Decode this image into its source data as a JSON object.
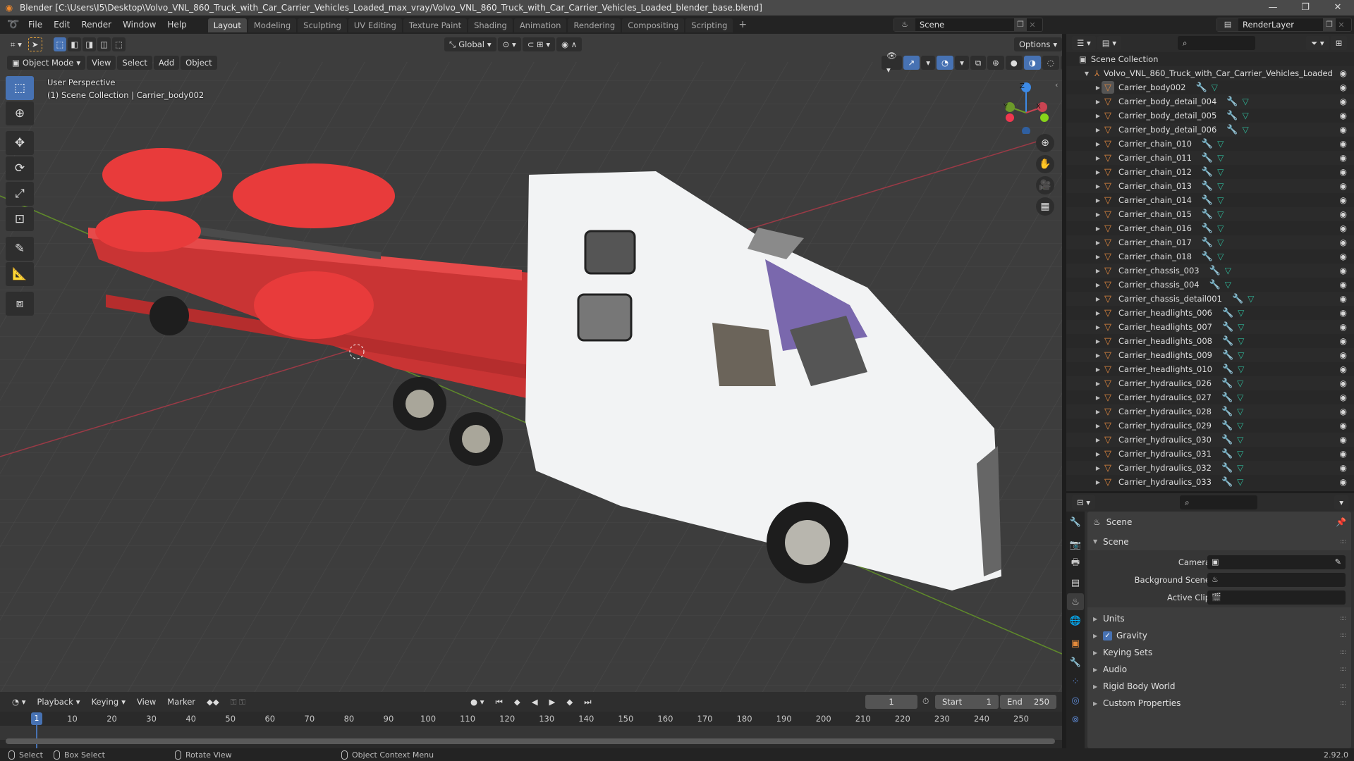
{
  "window": {
    "title": "Blender [C:\\Users\\I5\\Desktop\\Volvo_VNL_860_Truck_with_Car_Carrier_Vehicles_Loaded_max_vray/Volvo_VNL_860_Truck_with_Car_Carrier_Vehicles_Loaded_blender_base.blend]",
    "minimize": "—",
    "maximize": "❐",
    "close": "✕"
  },
  "menu": [
    "File",
    "Edit",
    "Render",
    "Window",
    "Help"
  ],
  "workspaces": [
    {
      "label": "Layout",
      "active": true
    },
    {
      "label": "Modeling"
    },
    {
      "label": "Sculpting"
    },
    {
      "label": "UV Editing"
    },
    {
      "label": "Texture Paint"
    },
    {
      "label": "Shading"
    },
    {
      "label": "Animation"
    },
    {
      "label": "Rendering"
    },
    {
      "label": "Compositing"
    },
    {
      "label": "Scripting"
    }
  ],
  "workspace_add": "+",
  "scene_selector": {
    "value": "Scene"
  },
  "view_layer_selector": {
    "value": "RenderLayer"
  },
  "viewport": {
    "header": {
      "transform_orientation": "Global",
      "options": "Options",
      "mode": "Object Mode",
      "menus": [
        "View",
        "Select",
        "Add",
        "Object"
      ]
    },
    "overlay_text": {
      "line1": "User Perspective",
      "line2": "(1) Scene Collection | Carrier_body002"
    },
    "gizmo": {
      "x": "X",
      "y": "Y",
      "z": "Z"
    },
    "colors": {
      "x_axis": "#c94452",
      "y_axis": "#6c9a2a",
      "z_axis": "#3d8ae6",
      "active_blue": "#4772b3"
    }
  },
  "outliner": {
    "root": "Scene Collection",
    "collection": "Volvo_VNL_860_Truck_with_Car_Carrier_Vehicles_Loaded",
    "items": [
      "Carrier_body002",
      "Carrier_body_detail_004",
      "Carrier_body_detail_005",
      "Carrier_body_detail_006",
      "Carrier_chain_010",
      "Carrier_chain_011",
      "Carrier_chain_012",
      "Carrier_chain_013",
      "Carrier_chain_014",
      "Carrier_chain_015",
      "Carrier_chain_016",
      "Carrier_chain_017",
      "Carrier_chain_018",
      "Carrier_chassis_003",
      "Carrier_chassis_004",
      "Carrier_chassis_detail001",
      "Carrier_headlights_006",
      "Carrier_headlights_007",
      "Carrier_headlights_008",
      "Carrier_headlights_009",
      "Carrier_headlights_010",
      "Carrier_hydraulics_026",
      "Carrier_hydraulics_027",
      "Carrier_hydraulics_028",
      "Carrier_hydraulics_029",
      "Carrier_hydraulics_030",
      "Carrier_hydraulics_031",
      "Carrier_hydraulics_032",
      "Carrier_hydraulics_033"
    ],
    "active_item": "Carrier_body002"
  },
  "properties": {
    "context": "Scene",
    "panel_title": "Scene",
    "fields": [
      {
        "label": "Camera",
        "value": ""
      },
      {
        "label": "Background Scene",
        "value": ""
      },
      {
        "label": "Active Clip",
        "value": ""
      }
    ],
    "sections": [
      {
        "label": "Units"
      },
      {
        "label": "Gravity",
        "checked": true
      },
      {
        "label": "Keying Sets"
      },
      {
        "label": "Audio"
      },
      {
        "label": "Rigid Body World"
      },
      {
        "label": "Custom Properties"
      }
    ]
  },
  "timeline": {
    "menus": [
      "Playback",
      "Keying",
      "View",
      "Marker"
    ],
    "current_frame": "1",
    "start_label": "Start",
    "start": "1",
    "end_label": "End",
    "end": "250",
    "ruler": [
      "1",
      "10",
      "20",
      "30",
      "40",
      "50",
      "60",
      "70",
      "80",
      "90",
      "100",
      "110",
      "120",
      "130",
      "140",
      "150",
      "160",
      "170",
      "180",
      "190",
      "200",
      "210",
      "220",
      "230",
      "240",
      "250"
    ]
  },
  "statusbar": {
    "select": "Select",
    "box_select": "Box Select",
    "rotate_view": "Rotate View",
    "context_menu": "Object Context Menu",
    "version": "2.92.0"
  }
}
